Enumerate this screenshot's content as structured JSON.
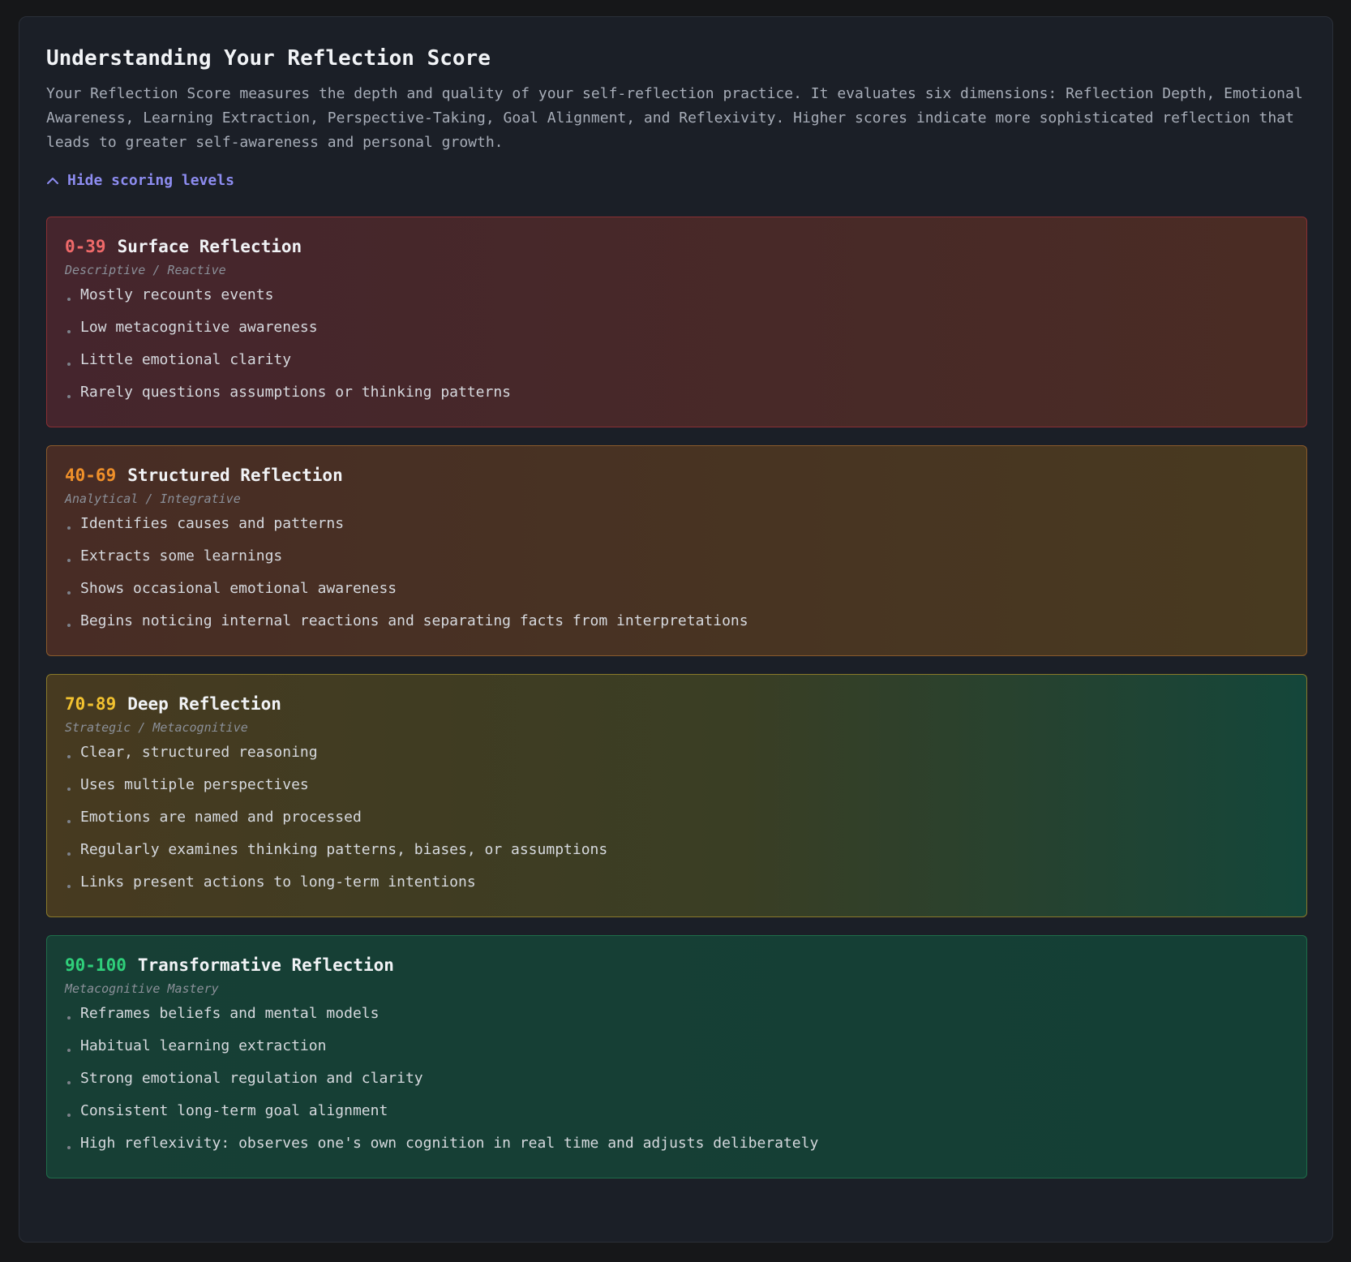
{
  "panel": {
    "title": "Understanding Your Reflection Score",
    "description": "Your Reflection Score measures the depth and quality of your self-reflection practice. It evaluates six dimensions: Reflection Depth, Emotional Awareness, Learning Extraction, Perspective-Taking, Goal Alignment, and Reflexivity. Higher scores indicate more sophisticated reflection that leads to greater self-awareness and personal growth.",
    "toggle_label": "Hide scoring levels",
    "toggle_icon": "chevron-up-icon"
  },
  "levels": [
    {
      "range": "0-39",
      "name": "Surface Reflection",
      "subtitle": "Descriptive / Reactive",
      "color": "#f06a6a",
      "items": [
        "Mostly recounts events",
        "Low metacognitive awareness",
        "Little emotional clarity",
        "Rarely questions assumptions or thinking patterns"
      ]
    },
    {
      "range": "40-69",
      "name": "Structured Reflection",
      "subtitle": "Analytical / Integrative",
      "color": "#f0902a",
      "items": [
        "Identifies causes and patterns",
        "Extracts some learnings",
        "Shows occasional emotional awareness",
        "Begins noticing internal reactions and separating facts from interpretations"
      ]
    },
    {
      "range": "70-89",
      "name": "Deep Reflection",
      "subtitle": "Strategic / Metacognitive",
      "color": "#f2c230",
      "items": [
        "Clear, structured reasoning",
        "Uses multiple perspectives",
        "Emotions are named and processed",
        "Regularly examines thinking patterns, biases, or assumptions",
        "Links present actions to long-term intentions"
      ]
    },
    {
      "range": "90-100",
      "name": "Transformative Reflection",
      "subtitle": "Metacognitive Mastery",
      "color": "#2fcf7a",
      "items": [
        "Reframes beliefs and mental models",
        "Habitual learning extraction",
        "Strong emotional regulation and clarity",
        "Consistent long-term goal alignment",
        "High reflexivity: observes one's own cognition in real time and adjusts deliberately"
      ]
    }
  ]
}
